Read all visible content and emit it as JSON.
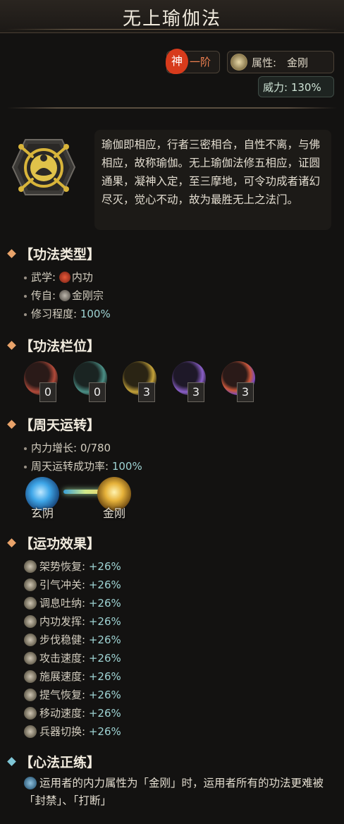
{
  "header": {
    "title": "无上瑜伽法"
  },
  "rank": {
    "seal": "神",
    "text": "一阶"
  },
  "attribute": {
    "label": "属性:",
    "value": "金刚"
  },
  "power": {
    "text": "威力: 130%"
  },
  "description": "瑜伽即相应，行者三密相合，自性不离，与佛相应，故称瑜伽。无上瑜伽法修五相应，证圆通果，凝神入定，至三摩地，可令功成者诸幻尽灭，觉心不动，故为最胜无上之法门。",
  "section_type": {
    "title": "【功法类型】",
    "martial_label": "武学:",
    "martial_value": "内功",
    "source_label": "传自:",
    "source_value": "金刚宗",
    "progress_label": "修习程度:",
    "progress_value": "100%"
  },
  "section_slots": {
    "title": "【功法栏位】",
    "slots": [
      {
        "count": "0",
        "color": "#b24a3a"
      },
      {
        "count": "0",
        "color": "#4b8f86"
      },
      {
        "count": "3",
        "color": "#c4a23a"
      },
      {
        "count": "3",
        "color": "#8a5fc8"
      },
      {
        "count": "3",
        "color": "#c8573a"
      }
    ]
  },
  "section_cycle": {
    "title": "【周天运转】",
    "gain_label": "内力增长:",
    "gain_value": "0/780",
    "rate_label": "周天运转成功率:",
    "rate_value": "100%",
    "from": "玄阴",
    "to": "金刚"
  },
  "section_effects": {
    "title": "【运功效果】",
    "items": [
      {
        "name": "架势恢复:",
        "value": "+26%"
      },
      {
        "name": "引气冲关:",
        "value": "+26%"
      },
      {
        "name": "调息吐纳:",
        "value": "+26%"
      },
      {
        "name": "内功发挥:",
        "value": "+26%"
      },
      {
        "name": "步伐稳健:",
        "value": "+26%"
      },
      {
        "name": "攻击速度:",
        "value": "+26%"
      },
      {
        "name": "施展速度:",
        "value": "+26%"
      },
      {
        "name": "提气恢复:",
        "value": "+26%"
      },
      {
        "name": "移动速度:",
        "value": "+26%"
      },
      {
        "name": "兵器切换:",
        "value": "+26%"
      }
    ]
  },
  "section_xinfa": {
    "title": "【心法正练】",
    "text": "运用者的内力属性为「金刚」时，运用者所有的功法更难被「封禁」、「打断」"
  },
  "colors": {
    "accent": "#e9a36a",
    "value": "#9fd4d4",
    "rank": "#d73b1c"
  }
}
